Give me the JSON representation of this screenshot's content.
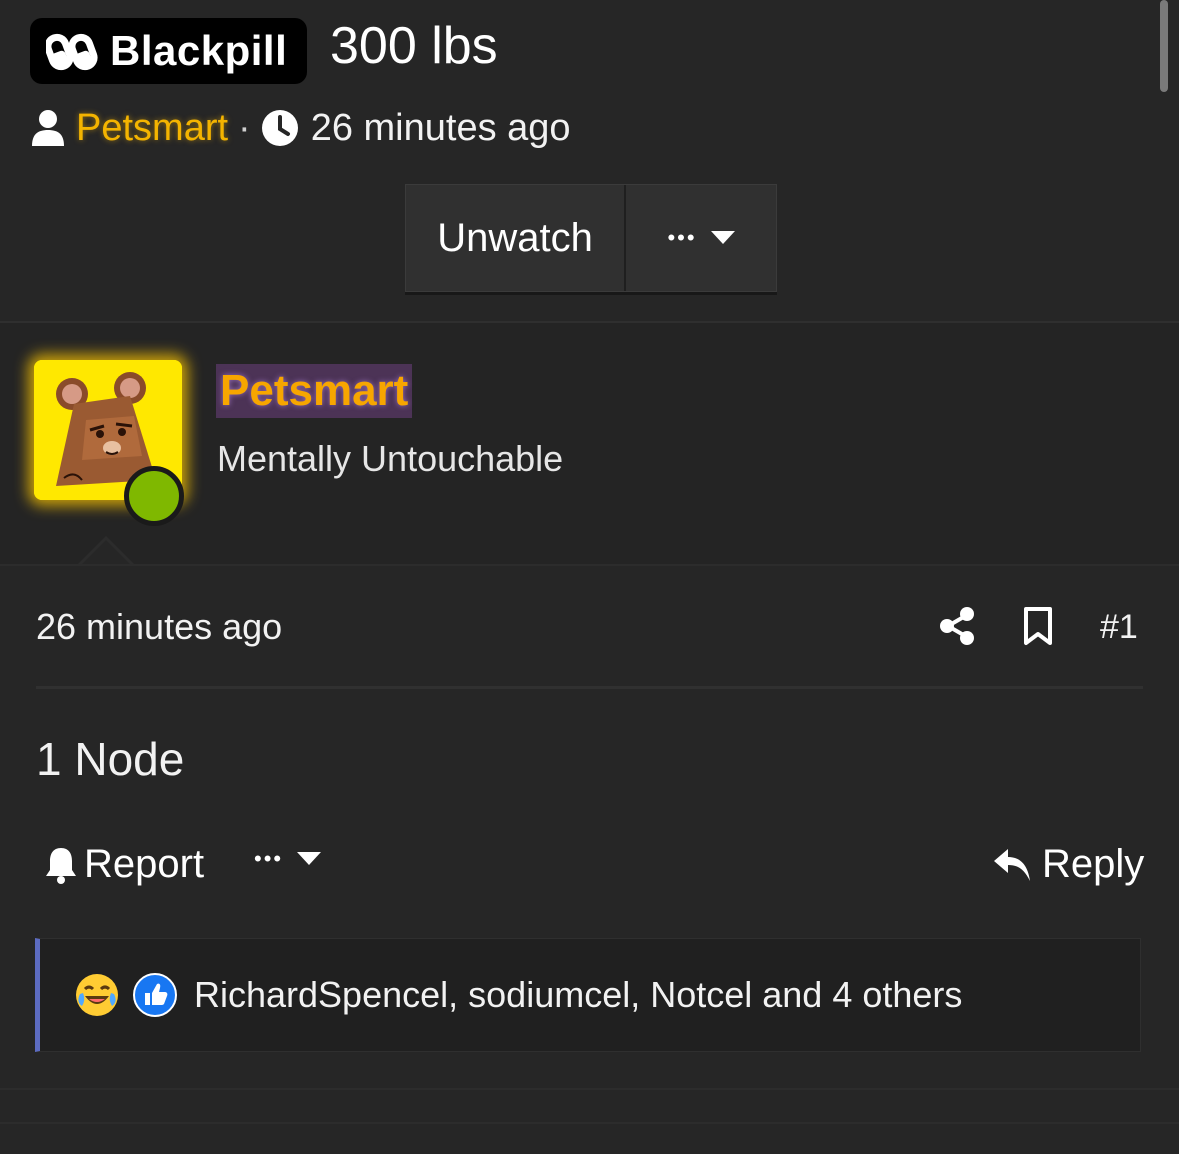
{
  "header": {
    "prefix_label": "Blackpill",
    "title": "300 lbs",
    "author": "Petsmart",
    "separator": "·",
    "time": "26 minutes ago"
  },
  "actions": {
    "unwatch_label": "Unwatch",
    "more_label": "•••"
  },
  "post": {
    "username": "Petsmart",
    "user_title": "Mentally Untouchable",
    "online": true,
    "time": "26 minutes ago",
    "number": "#1",
    "content": "1 Node",
    "report_label": "Report",
    "more_label": "•••",
    "reply_label": "Reply",
    "reactions": {
      "icons": [
        "laughing-crying-emoji",
        "thumbs-up-icon"
      ],
      "text": "RichardSpencel, sodiumcel, Notcel and 4 others"
    }
  },
  "colors": {
    "background": "#262626",
    "author": "#f4b400",
    "username": "#f7a600",
    "avatar_bg": "#ffe800",
    "online": "#7fb800",
    "reaction_border": "#5c6bc0"
  }
}
